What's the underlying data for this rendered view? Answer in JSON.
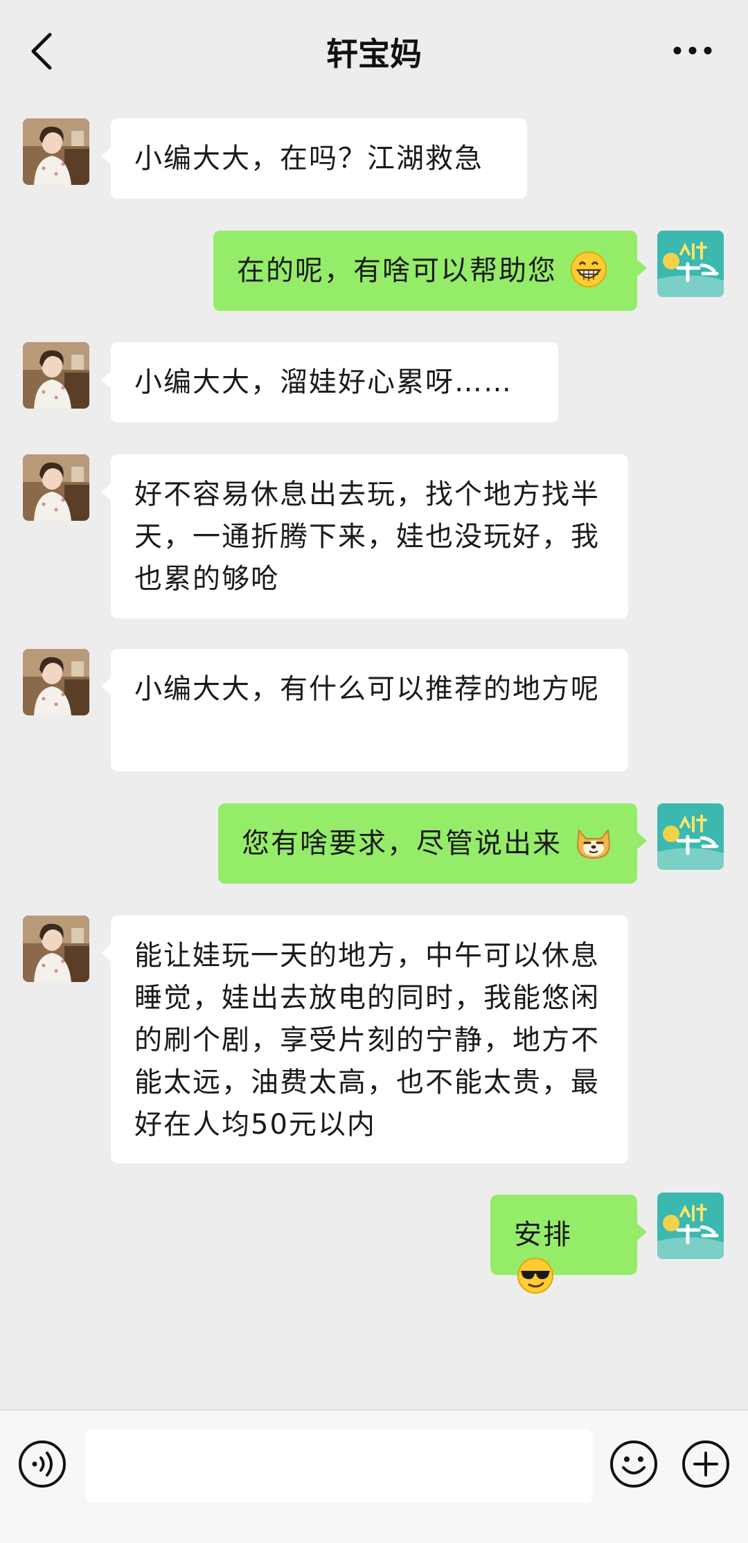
{
  "header": {
    "title": "轩宝妈",
    "back_icon": "chevron-left-icon",
    "more_icon": "more-dots-icon"
  },
  "messages": [
    {
      "side": "in",
      "text": "小编大大，在吗？江湖救急"
    },
    {
      "side": "out",
      "text": "在的呢，有啥可以帮助您",
      "emoji": "grin-emoji"
    },
    {
      "side": "in",
      "text": "小编大大，溜娃好心累呀……"
    },
    {
      "side": "in",
      "text": "好不容易休息出去玩，找个地方找半天，一通折腾下来，娃也没玩好，我也累的够呛"
    },
    {
      "side": "in",
      "text": "小编大大，有什么可以推荐的地方呢"
    },
    {
      "side": "out",
      "text": "您有啥要求，尽管说出来",
      "emoji": "doge-emoji"
    },
    {
      "side": "in",
      "text": "能让娃玩一天的地方，中午可以休息睡觉，娃出去放电的同时，我能悠闲的刷个剧，享受片刻的宁静，地方不能太远，油费太高，也不能太贵，最好在人均50元以内"
    },
    {
      "side": "out",
      "text": "安排",
      "emoji": "sunglasses-emoji"
    }
  ],
  "footer": {
    "voice_icon": "voice-icon",
    "input_value": "",
    "emoji_icon": "smile-icon",
    "plus_icon": "plus-icon"
  },
  "colors": {
    "background": "#ededed",
    "incoming_bubble": "#ffffff",
    "outgoing_bubble": "#95ec69",
    "my_avatar_bg": "#3bb8b0"
  }
}
